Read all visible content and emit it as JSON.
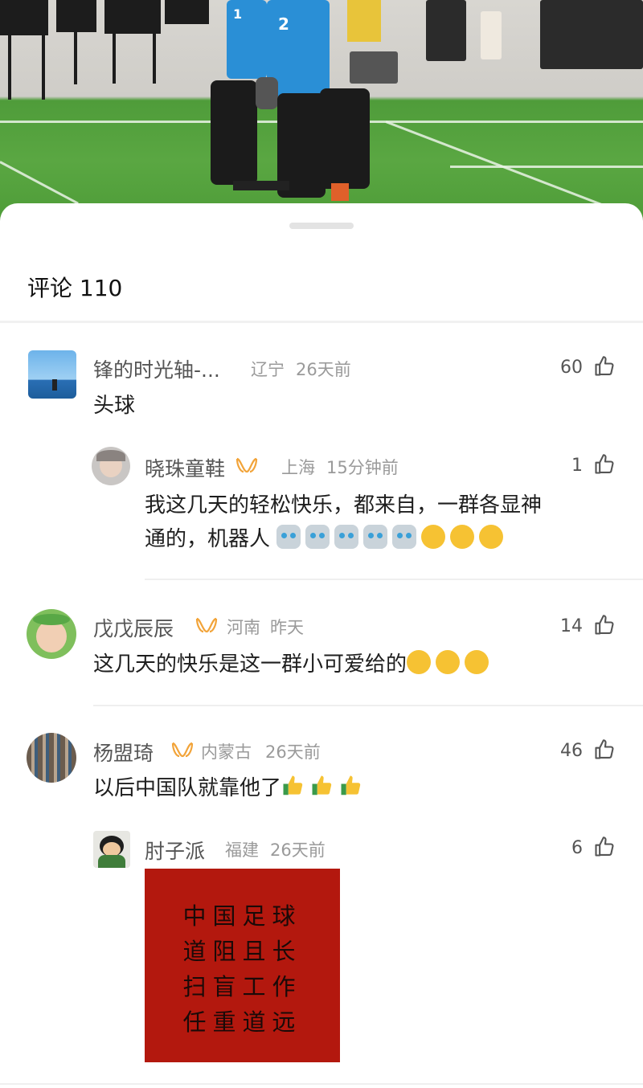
{
  "video": {
    "jersey_numbers": [
      "1",
      "2"
    ]
  },
  "sheet": {
    "title": "评论 110"
  },
  "comments": [
    {
      "name": "锋的时光轴-...",
      "location": "辽宁",
      "time": "26天前",
      "text": "头球",
      "likes": "60"
    },
    {
      "name": "晓珠童鞋",
      "location": "上海",
      "time": "15分钟前",
      "text_line1": "我这几天的轻松快乐，都来自，一群各显神",
      "text_line2": "通的，机器人",
      "likes": "1",
      "emojis": [
        "robot",
        "robot",
        "robot",
        "robot",
        "robot",
        "grin",
        "laugh-cry",
        "666"
      ]
    },
    {
      "name": "戊戊辰辰",
      "location": "河南",
      "time": "昨天",
      "text": "这几天的快乐是这一群小可爱给的",
      "likes": "14",
      "emojis": [
        "laugh-cry",
        "laugh-cry",
        "laugh-cry"
      ]
    },
    {
      "name": "杨盟琦",
      "location": "内蒙古",
      "time": "26天前",
      "text": "以后中国队就靠他了",
      "likes": "46",
      "emojis": [
        "thumbs-up",
        "thumbs-up",
        "thumbs-up"
      ]
    },
    {
      "name": "肘子派",
      "location": "福建",
      "time": "26天前",
      "likes": "6",
      "image_lines": [
        "中国足球",
        "道阻且长",
        "扫盲工作",
        "任重道远"
      ]
    }
  ],
  "colors": {
    "badge": "#f2a43a",
    "poster": "#b3180e",
    "emoji_yellow": "#f6c233"
  }
}
